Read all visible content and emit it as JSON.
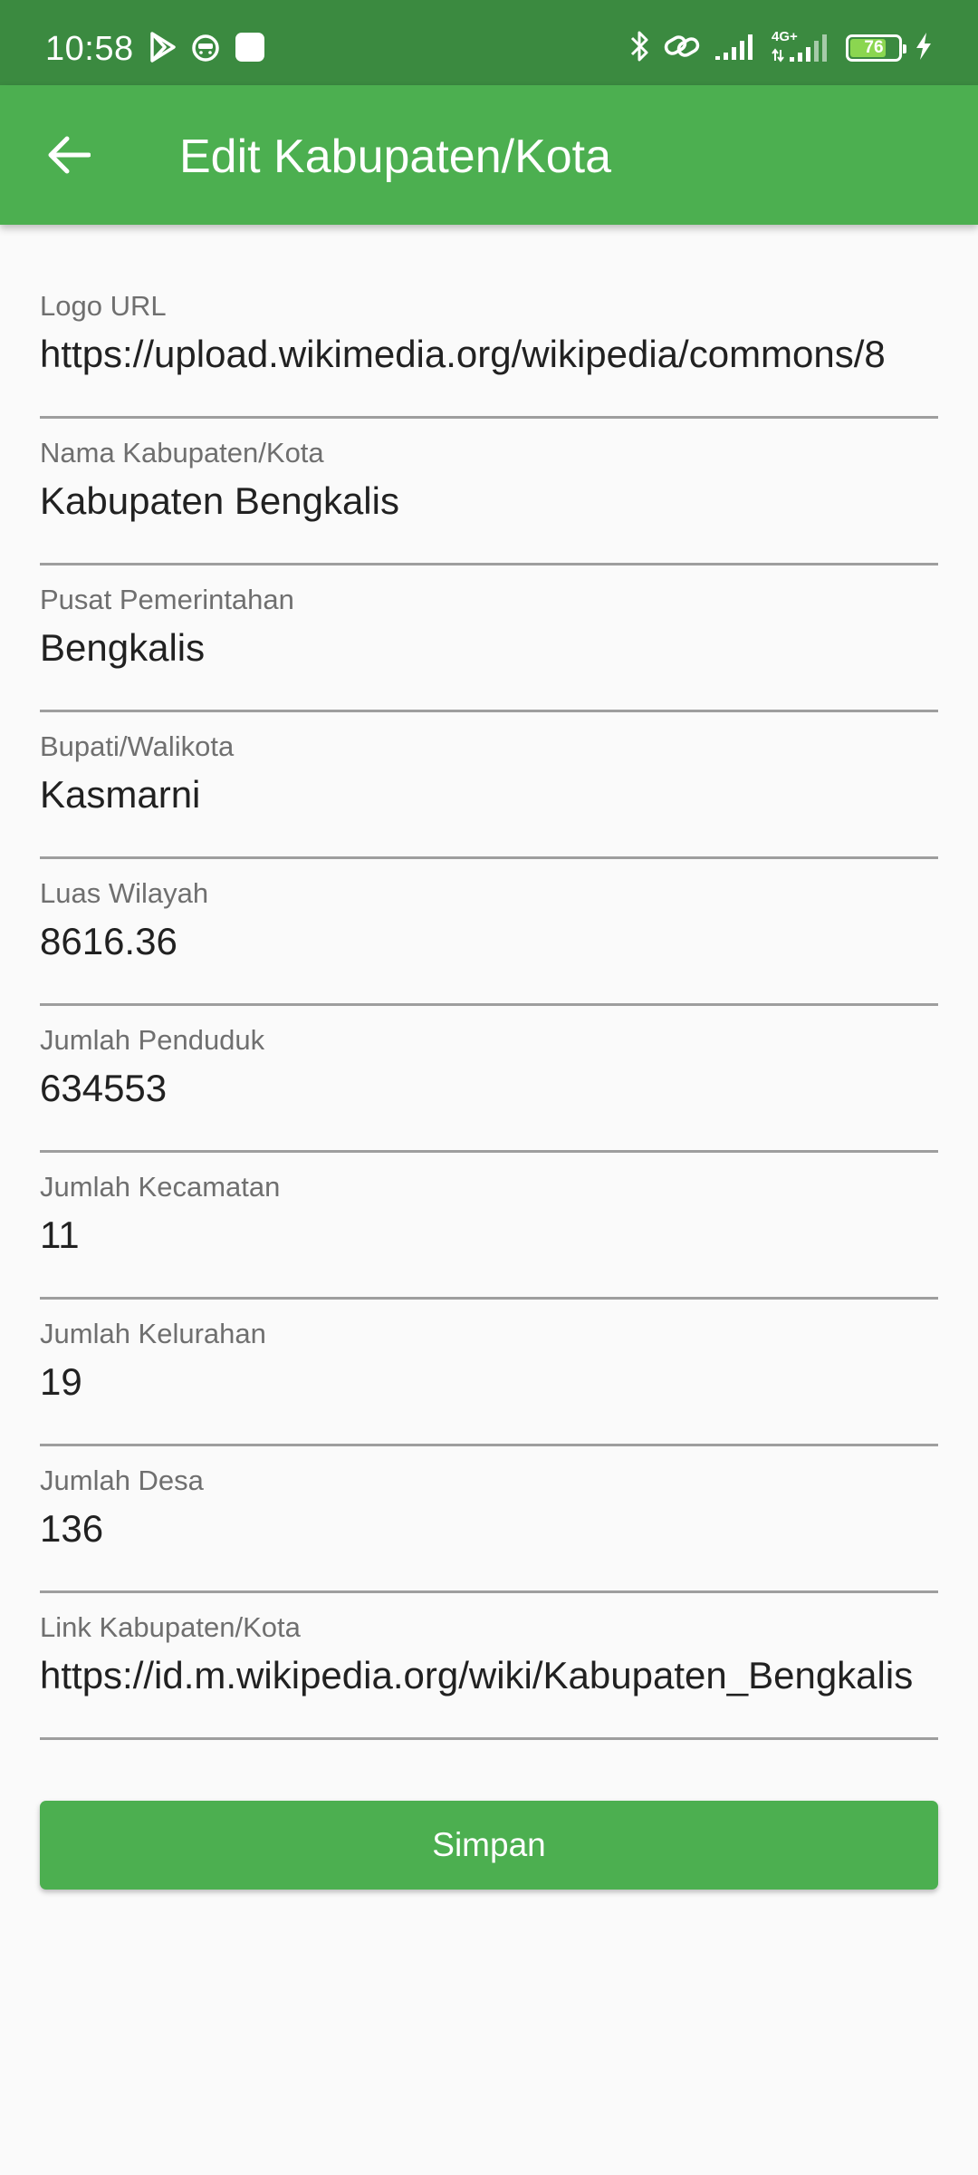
{
  "status_bar": {
    "time": "10:58",
    "battery_level": 76,
    "network_label": "4G+"
  },
  "appbar": {
    "title": "Edit Kabupaten/Kota",
    "back_icon": "arrow-back-icon"
  },
  "form": {
    "fields": [
      {
        "label": "Logo URL",
        "value": "https://upload.wikimedia.org/wikipedia/commons/8"
      },
      {
        "label": "Nama Kabupaten/Kota",
        "value": "Kabupaten Bengkalis"
      },
      {
        "label": "Pusat Pemerintahan",
        "value": "Bengkalis"
      },
      {
        "label": "Bupati/Walikota",
        "value": "Kasmarni"
      },
      {
        "label": "Luas Wilayah",
        "value": "8616.36"
      },
      {
        "label": "Jumlah Penduduk",
        "value": "634553"
      },
      {
        "label": "Jumlah Kecamatan",
        "value": "11"
      },
      {
        "label": "Jumlah Kelurahan",
        "value": "19"
      },
      {
        "label": "Jumlah Desa",
        "value": "136"
      },
      {
        "label": "Link Kabupaten/Kota",
        "value": "https://id.m.wikipedia.org/wiki/Kabupaten_Bengkalis"
      }
    ]
  },
  "save_button": {
    "label": "Simpan"
  },
  "colors": {
    "status_bar": "#3b8a40",
    "primary": "#4caf50",
    "background": "#fafafa",
    "battery_fill": "#8bd650"
  }
}
